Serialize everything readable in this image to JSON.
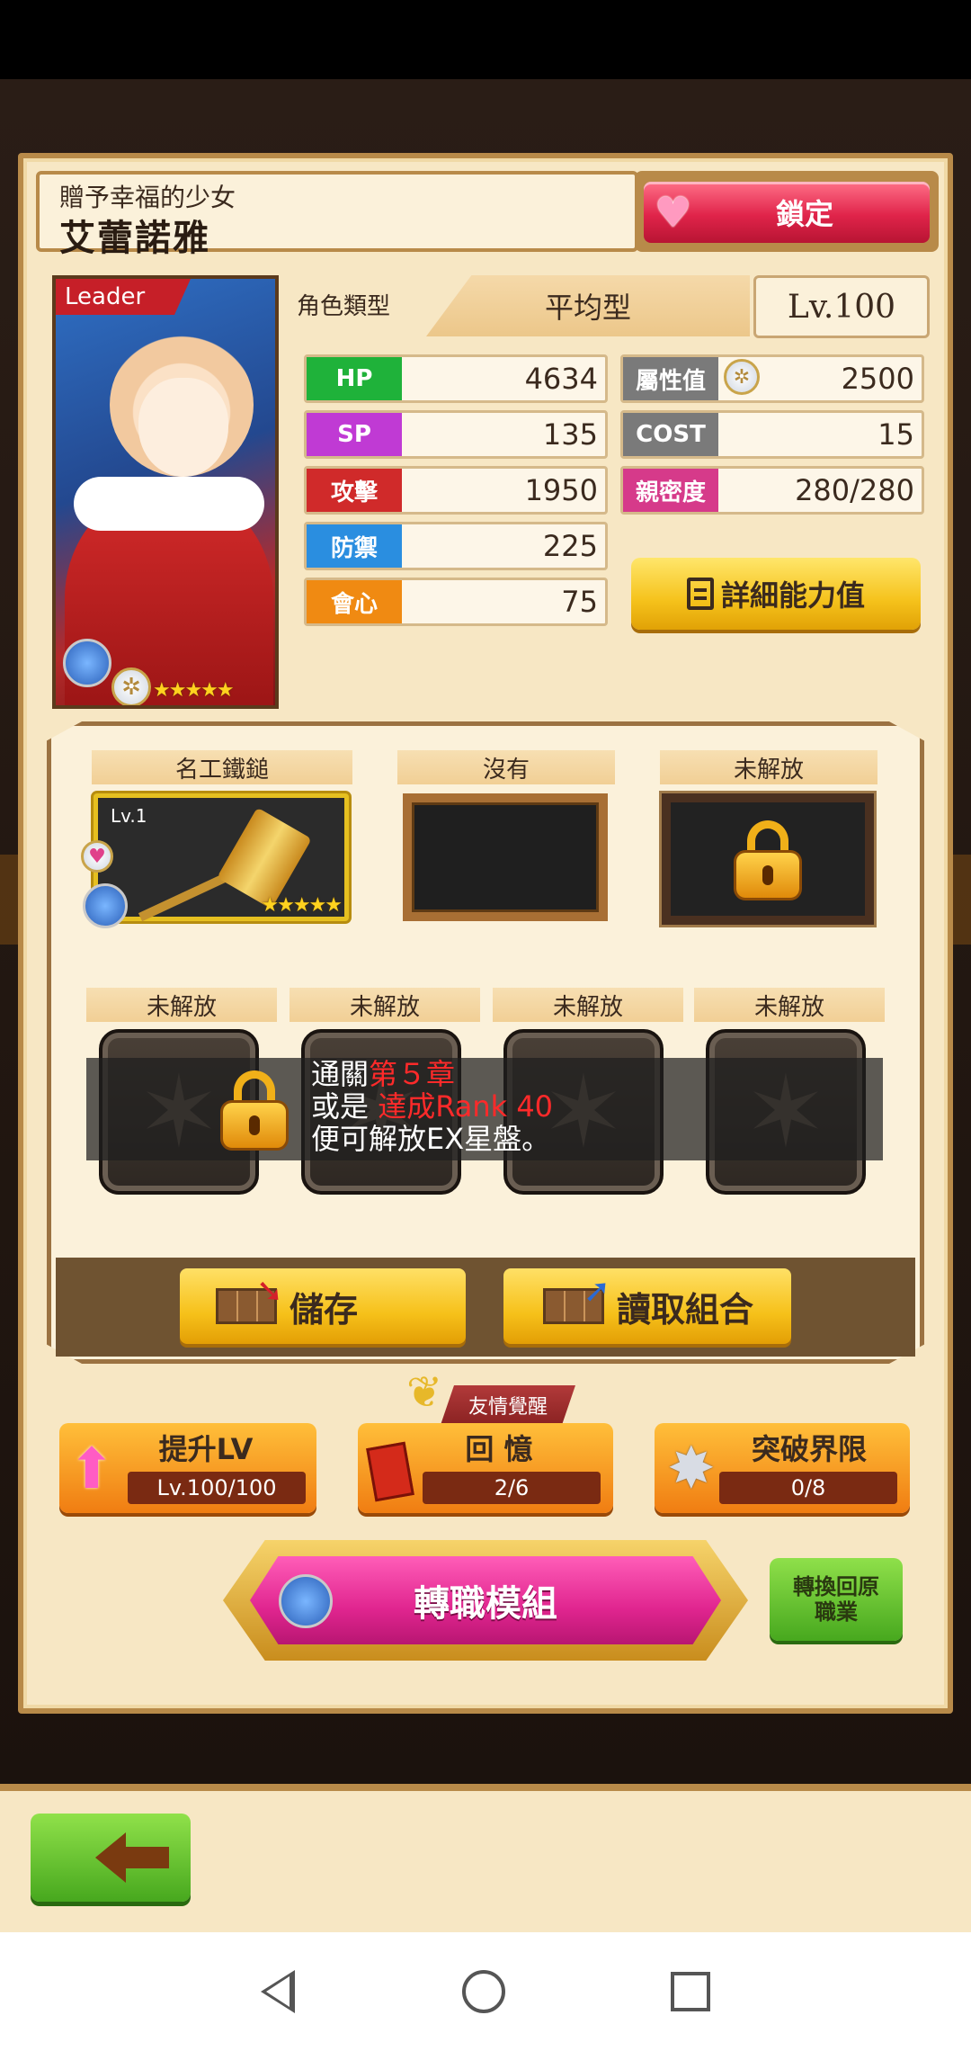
{
  "header": {
    "subtitle": "贈予幸福的少女",
    "name": "艾蕾諾雅",
    "lock_label": "鎖定"
  },
  "portrait": {
    "leader_label": "Leader",
    "rarity_stars": "★★★★★"
  },
  "type": {
    "label": "角色類型",
    "value": "平均型",
    "level": "Lv.100"
  },
  "stats_left": [
    {
      "label": "HP",
      "value": "4634",
      "color": "#1fb23a"
    },
    {
      "label": "SP",
      "value": "135",
      "color": "#c03ad4"
    },
    {
      "label": "攻擊",
      "value": "1950",
      "color": "#d02a2a"
    },
    {
      "label": "防禦",
      "value": "225",
      "color": "#2a8ee0"
    },
    {
      "label": "會心",
      "value": "75",
      "color": "#f08a12"
    }
  ],
  "stats_right": [
    {
      "label": "屬性值",
      "value": "2500",
      "color": "#7a7a7a"
    },
    {
      "label": "COST",
      "value": "15",
      "color": "#7a7a7a"
    },
    {
      "label": "親密度",
      "value": "280/280",
      "color": "#d63a8a"
    }
  ],
  "detail_button": "詳細能力值",
  "equipment": {
    "slots": [
      {
        "label": "名工鐵鎚"
      },
      {
        "label": "沒有"
      },
      {
        "label": "未解放"
      }
    ],
    "weapon_level": "Lv.1",
    "weapon_stars": "★★★★★"
  },
  "ex_slots": {
    "labels": [
      "未解放",
      "未解放",
      "未解放",
      "未解放"
    ],
    "message_line1_a": "通關",
    "message_line1_b": "第５章",
    "message_line2_a": "或是",
    "message_line2_b": "達成Rank 40",
    "message_line3": "便可解放EX星盤。"
  },
  "actions": {
    "save": "儲存",
    "load": "讀取組合"
  },
  "bottom": {
    "friend_tag": "友情覺醒",
    "level_up": {
      "title": "提升LV",
      "value": "Lv.100/100"
    },
    "memory": {
      "title": "回 憶",
      "value": "2/6"
    },
    "limit_break": {
      "title": "突破界限",
      "value": "0/8"
    },
    "job_change": "轉職模組",
    "revert_job": "轉換回原職業"
  }
}
